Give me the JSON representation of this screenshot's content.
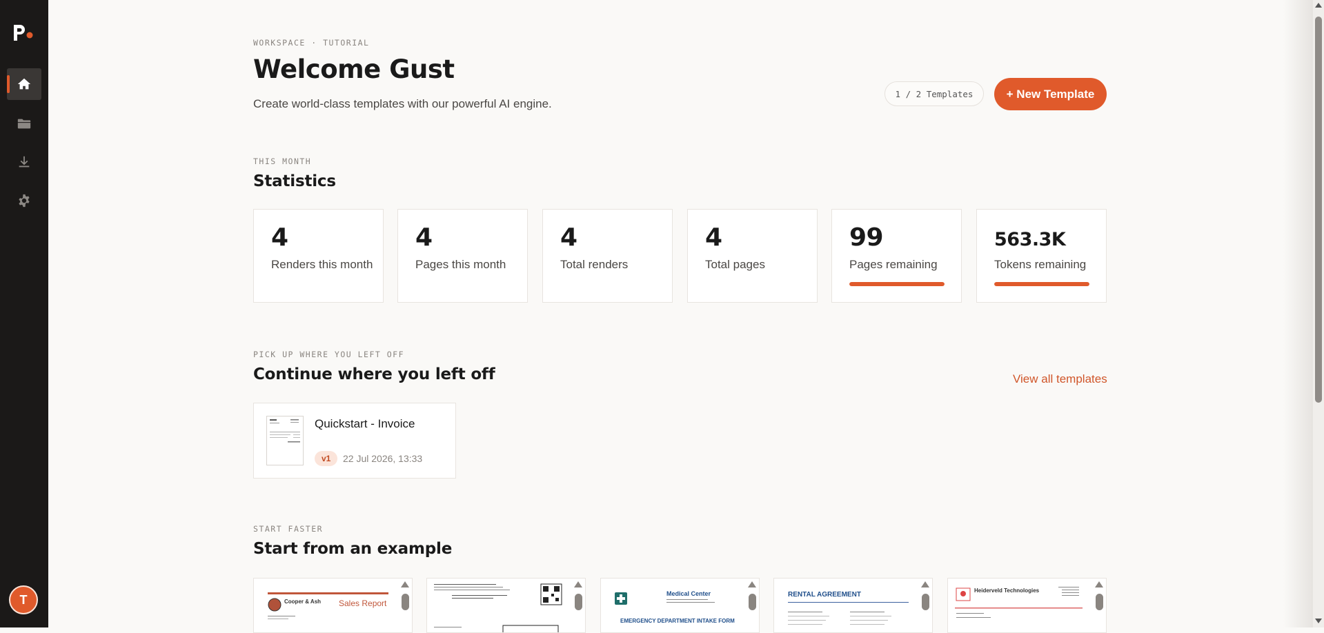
{
  "sidebar": {
    "logo": "p.",
    "items": [
      {
        "icon": "home-icon",
        "active": true
      },
      {
        "icon": "folder-icon",
        "active": false
      },
      {
        "icon": "download-icon",
        "active": false
      },
      {
        "icon": "gear-icon",
        "active": false
      }
    ],
    "avatar_initial": "T"
  },
  "header": {
    "breadcrumb": "WORKSPACE · TUTORIAL",
    "title": "Welcome Gust",
    "subtitle": "Create world-class templates with our powerful AI engine.",
    "templates_count": "1 / 2 Templates",
    "new_template_label": "+ New Template"
  },
  "stats": {
    "eyebrow": "THIS MONTH",
    "title": "Statistics",
    "cards": [
      {
        "value": "4",
        "label": "Renders this month"
      },
      {
        "value": "4",
        "label": "Pages this month"
      },
      {
        "value": "4",
        "label": "Total renders"
      },
      {
        "value": "4",
        "label": "Total pages"
      },
      {
        "value": "99",
        "label": "Pages remaining",
        "progress": 1.0
      },
      {
        "value": "563.3K",
        "label": "Tokens remaining",
        "progress": 1.0
      }
    ]
  },
  "continue": {
    "eyebrow": "PICK UP WHERE YOU LEFT OFF",
    "title": "Continue where you left off",
    "view_all": "View all templates",
    "recent": {
      "title": "Quickstart - Invoice",
      "version": "v1",
      "date": "22 Jul 2026, 13:33"
    }
  },
  "examples": {
    "eyebrow": "START FASTER",
    "title": "Start from an example",
    "items": [
      {
        "title": "Sales Report",
        "company": "Cooper & Ash"
      },
      {
        "title": "",
        "company": ""
      },
      {
        "title": "EMERGENCY DEPARTMENT INTAKE FORM",
        "company": "Medical Center"
      },
      {
        "title": "RENTAL AGREEMENT",
        "company": ""
      },
      {
        "title": "",
        "company": "Heiderveld Technologies"
      }
    ]
  },
  "colors": {
    "accent": "#e05a2b",
    "sidebar": "#1b1918",
    "background": "#faf9f7"
  }
}
